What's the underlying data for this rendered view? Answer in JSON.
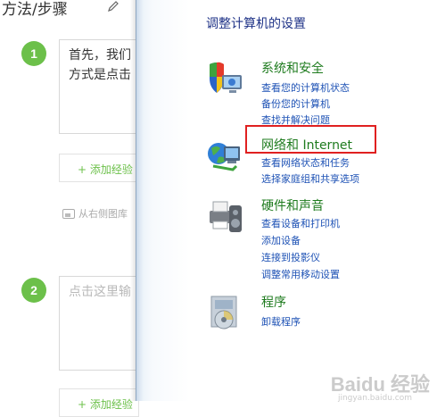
{
  "editor": {
    "method_title": "方法/步骤",
    "steps": [
      {
        "number": "1",
        "text_line1": "首先，我们",
        "text_line2": "方式是点击"
      },
      {
        "number": "2",
        "placeholder": "点击这里输"
      }
    ],
    "add_experience_label": "+ 添加经验",
    "image_hint": "从右侧图库"
  },
  "control_panel": {
    "title": "调整计算机的设置",
    "categories": [
      {
        "heading": "系统和安全",
        "icon": "shield-computer-icon",
        "links": [
          "查看您的计算机状态",
          "备份您的计算机",
          "查找并解决问题"
        ]
      },
      {
        "heading": "网络和 Internet",
        "icon": "network-globe-icon",
        "links": [
          "查看网络状态和任务",
          "选择家庭组和共享选项"
        ]
      },
      {
        "heading": "硬件和声音",
        "icon": "printer-speaker-icon",
        "links": [
          "查看设备和打印机",
          "添加设备",
          "连接到投影仪",
          "调整常用移动设置"
        ]
      },
      {
        "heading": "程序",
        "icon": "programs-disc-icon",
        "links": [
          "卸载程序"
        ]
      }
    ]
  },
  "watermark": {
    "text": "Baidu 经验",
    "sub": "jingyan.baidu.com"
  },
  "colors": {
    "step_green": "#6cc04a",
    "heading_green": "#1e7b1e",
    "link_blue": "#1e52b5",
    "title_blue": "#1e3287",
    "highlight_red": "#e02020"
  }
}
